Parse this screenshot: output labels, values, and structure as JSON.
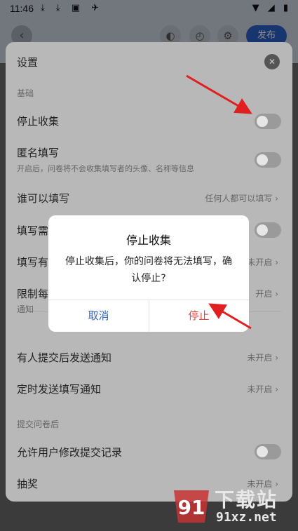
{
  "status_bar": {
    "time": "11:46",
    "left_icons": "⤓ ⤓ ▣ ✈",
    "right_icons": "▼ ◢ ▮"
  },
  "header": {
    "back_icon": "‹",
    "icons": [
      "◐",
      "◴",
      "⚙"
    ],
    "publish_label": "发布"
  },
  "sheet": {
    "title": "设置",
    "close_icon": "✕",
    "sections": {
      "basic": "基础",
      "notify": "通知",
      "after_submit": "提交问卷后"
    },
    "rows": {
      "stop_collect": "停止收集",
      "anonymous": "匿名填写",
      "anonymous_sub": "开启后，问卷将不会收集填写者的头像、名称等信息",
      "who_can_fill": "谁可以填写",
      "who_can_fill_value": "任何人都可以填写",
      "fill_need_partial": "填写需",
      "fill_time_partial": "填写有",
      "fill_time_value": "未开启",
      "limit_partial": "限制每",
      "limit_value": "开启",
      "notify_on_submit": "有人提交后发送通知",
      "notify_on_submit_value": "未开启",
      "timed_notify": "定时发送填写通知",
      "timed_notify_value": "未开启",
      "allow_modify": "允许用户修改提交记录",
      "lottery": "抽奖",
      "lottery_value": "未开启"
    },
    "chevron": "›"
  },
  "dialog": {
    "title": "停止收集",
    "message": "停止收集后，你的问卷将无法填写，确认停止?",
    "cancel_label": "取消",
    "stop_label": "停止"
  },
  "watermark": {
    "badge": "91",
    "text_top": "下载站",
    "text_bottom": "91xz.net"
  }
}
